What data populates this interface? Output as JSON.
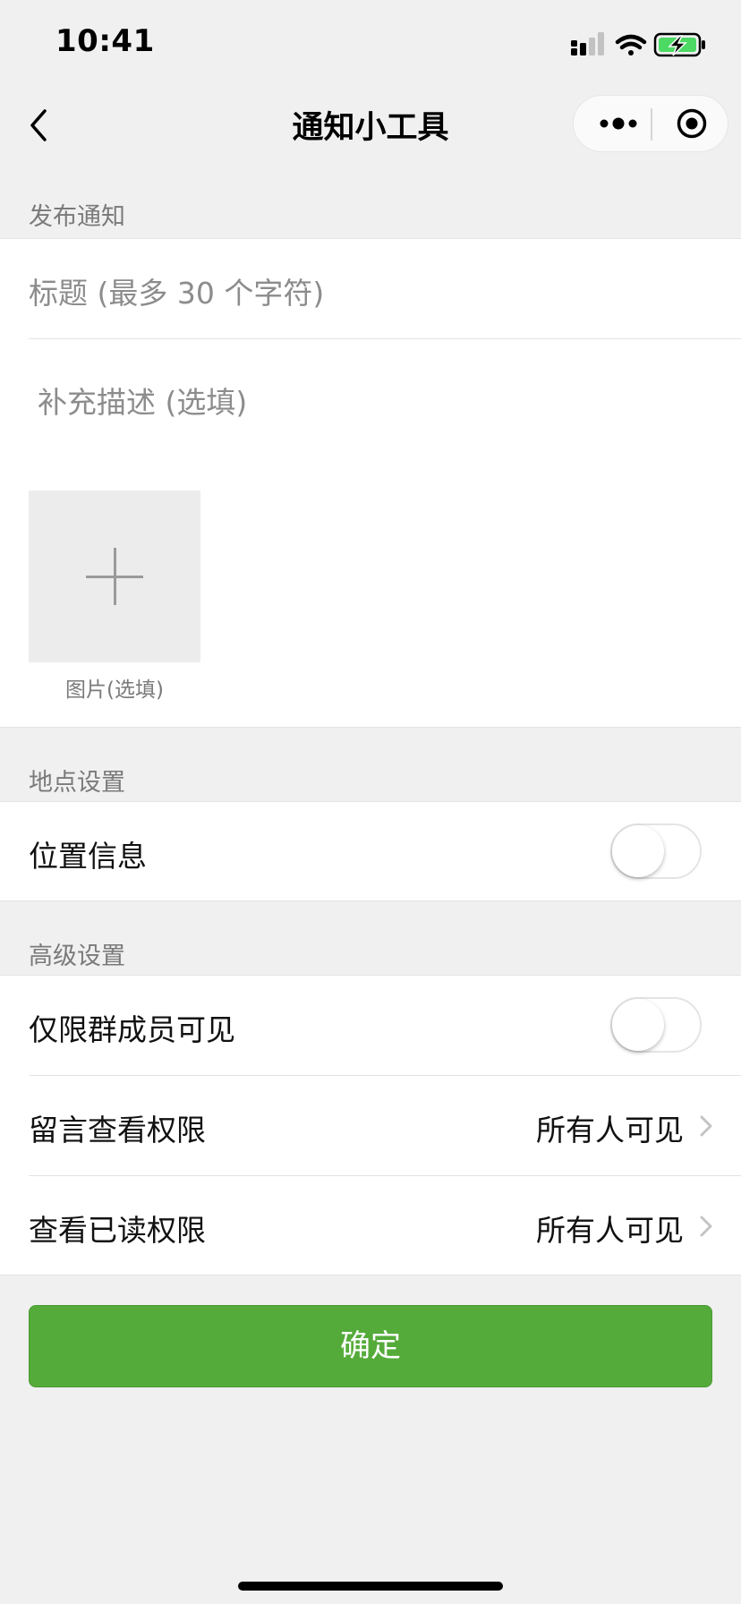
{
  "status_bar": {
    "time": "10:41"
  },
  "nav": {
    "title": "通知小工具"
  },
  "publish": {
    "header": "发布通知",
    "title_placeholder": "标题 (最多 30 个字符)",
    "desc_placeholder": "补充描述 (选填)",
    "image_caption": "图片(选填)"
  },
  "location": {
    "header": "地点设置",
    "location_label": "位置信息",
    "location_on": false
  },
  "advanced": {
    "header": "高级设置",
    "members_only_label": "仅限群成员可见",
    "members_only_on": false,
    "comment_label": "留言查看权限",
    "comment_value": "所有人可见",
    "read_label": "查看已读权限",
    "read_value": "所有人可见"
  },
  "confirm_label": "确定",
  "colors": {
    "primary": "#55ab3a",
    "background": "#f0f0f0"
  }
}
